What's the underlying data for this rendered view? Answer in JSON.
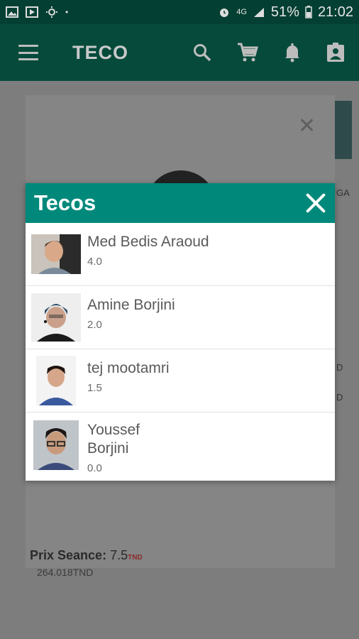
{
  "status_bar": {
    "battery": "51%",
    "time": "21:02",
    "network": "4G"
  },
  "app_bar": {
    "title": "TECO",
    "icons": [
      "menu-icon",
      "search-icon",
      "cart-icon",
      "bell-icon",
      "account-icon"
    ]
  },
  "background": {
    "prix_label": "Prix Seance:",
    "prix_value": "7.5",
    "prix_currency": "TND",
    "price2": "264.018TND",
    "side_text_1": "GA",
    "side_text_2": "D",
    "side_text_3": "D"
  },
  "dialog": {
    "title": "Tecos",
    "items": [
      {
        "name": "Med Bedis Araoud",
        "score": "4.0",
        "avatar": "boy-glasses-photo"
      },
      {
        "name": "Amine Borjini",
        "score": "2.0",
        "avatar": "boy-beanie-photo"
      },
      {
        "name": "tej mootamri",
        "score": "1.5",
        "avatar": "boy-portrait-photo"
      },
      {
        "name": "Youssef Borjini",
        "score": "0.0",
        "avatar": "boy-glasses-photo"
      }
    ]
  },
  "colors": {
    "header_teal": "#00897b",
    "appbar_dark": "#064a3b"
  }
}
